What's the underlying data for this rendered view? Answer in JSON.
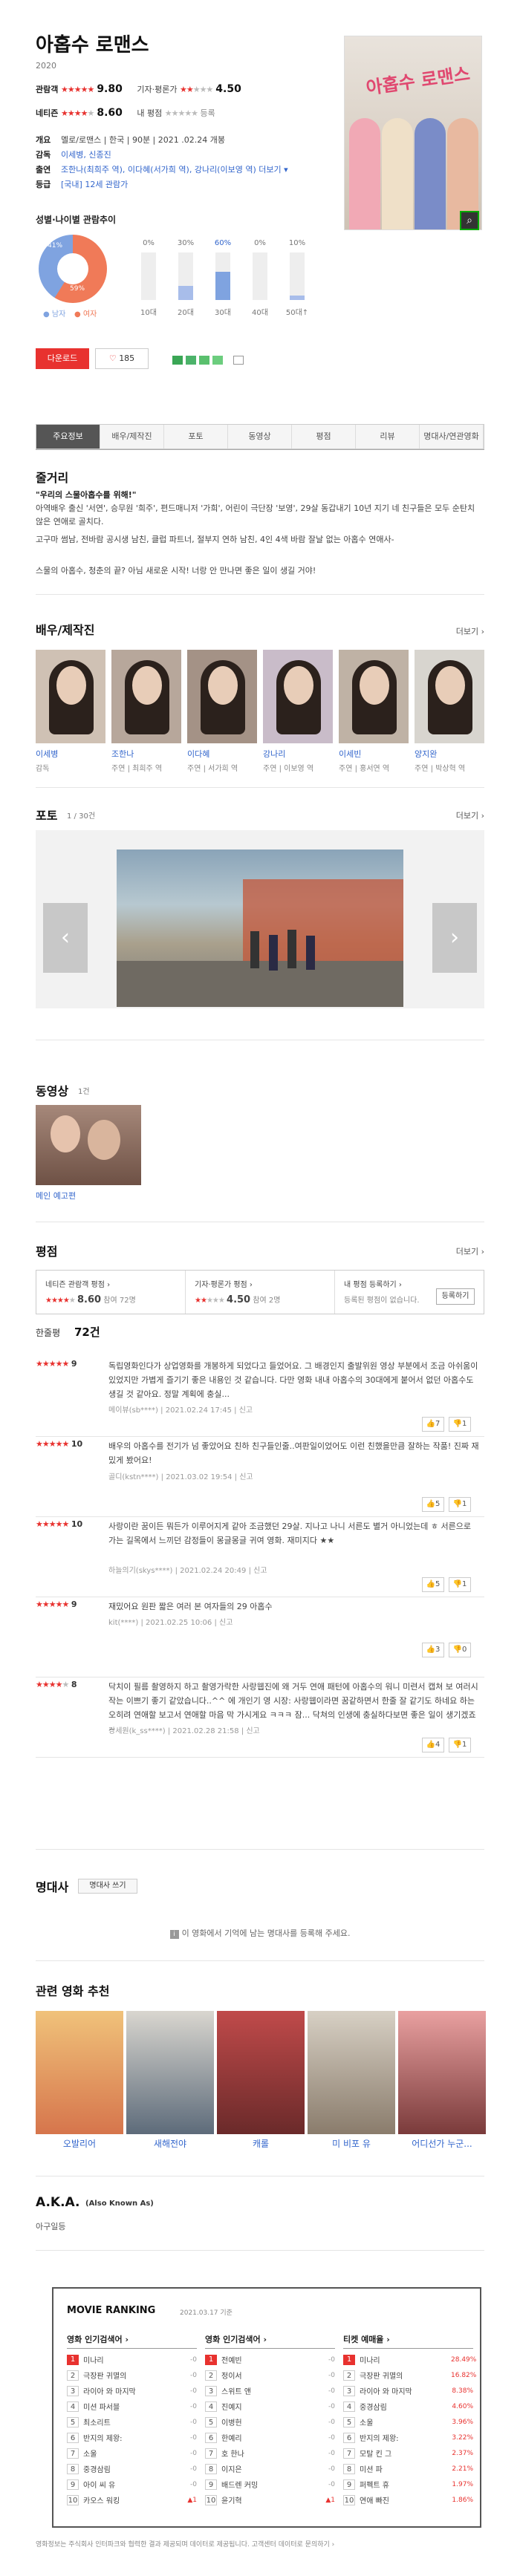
{
  "movie": {
    "title": "아홉수 로맨스",
    "year": "2020"
  },
  "info": {
    "audience_label": "관람객",
    "audience_score": "9.80",
    "critic_label": "기자·평론가",
    "critic_score": "4.50",
    "netizen_label": "네티즌",
    "netizen_score": "8.60",
    "my_label": "내 평점",
    "my_rate": "등록",
    "genre_label": "개요",
    "genre": "멜로/로맨스 | 한국 | 90분 | 2021 .02.24 개봉",
    "director_label": "감독",
    "director": "이세병, 신종진",
    "cast_label": "출연",
    "cast": "조한나(최희주 역), 이다혜(서가희 역), 강나리(이보영 역) 더보기 ▾",
    "rating_label": "등급",
    "rating": "[국내] 12세 관람가"
  },
  "gender": {
    "title": "성별·나이별 관람추이",
    "male_pct": "41%",
    "female_pct": "59%",
    "male": "● 남자",
    "female": "● 여자",
    "ages": [
      {
        "label": "10대",
        "pct": "0%",
        "v": 0
      },
      {
        "label": "20대",
        "pct": "30%",
        "v": 30
      },
      {
        "label": "30대",
        "pct": "60%",
        "v": 60
      },
      {
        "label": "40대",
        "pct": "0%",
        "v": 0
      },
      {
        "label": "50대↑",
        "pct": "10%",
        "v": 10
      }
    ]
  },
  "actions": {
    "download": "다운로드",
    "like_count": "185"
  },
  "tabs": [
    "주요정보",
    "배우/제작진",
    "포토",
    "동영상",
    "평점",
    "리뷰",
    "명대사/연관영화"
  ],
  "plot": {
    "title": "줄거리",
    "headline": "\"우리의 스물아홉수를 위해!\"",
    "body1": "아역배우 출신 '서연', 승무원 '희주', 편드매니저 '가희', 어린이 극단장 '보영', 29살 동갑내기 10년 지기 네 친구들은 모두 순탄치 않은 연애로 골치다.",
    "body2": "고구마 썸남, 전바람 공시생 남친, 클럽 파트너, 절부지 연하 남친, 4인 4색 바람 잘날 없는 아홉수 연애사-",
    "body3": "스물의 아홉수, 청춘의 끝? 아님 새로운 시작! 너랑 안 만나면 좋은 일이 생길 거야!"
  },
  "people": {
    "title": "배우/제작진",
    "more": "더보기 ›",
    "list": [
      {
        "name": "이세병",
        "role": "감독"
      },
      {
        "name": "조한나",
        "role": "주연 | 최희주 역"
      },
      {
        "name": "이다혜",
        "role": "주연 | 서가희 역"
      },
      {
        "name": "강나리",
        "role": "주연 | 이보영 역"
      },
      {
        "name": "이세빈",
        "role": "주연 | 홍서연 역"
      },
      {
        "name": "양지완",
        "role": "주연 | 박상혁 역"
      }
    ]
  },
  "photo": {
    "title": "포토",
    "count": "1 / 30건",
    "more": "더보기 ›"
  },
  "video": {
    "title": "동영상",
    "count": "1건",
    "name": "메인 예고편"
  },
  "ratings": {
    "title": "평점",
    "more": "더보기 ›",
    "netizen": {
      "label": "네티즌 관람객 평점 ›",
      "score": "8.60",
      "n": "참여 72명"
    },
    "critic": {
      "label": "기자·평론가 평점 ›",
      "score": "4.50",
      "n": "참여 2명"
    },
    "mine": {
      "label": "내 평점 등록하기 ›",
      "desc": "등록된 평점이 없습니다.",
      "btn": "등록하기"
    },
    "count_label": "한줄평",
    "count": "72건"
  },
  "reviews": [
    {
      "score": "9",
      "text": "독립영화인다가 상업영화를 개봉하게 되었다고 들었어요. 그 배경인지 출발위원 영상 부분에서 조금 아쉬움이 있었지만 가볍게 즐기기 좋은 내용인 것 같습니다. 다만 영화 내내 아홉수의 30대에게 붙어서 없던 아홉수도 생길 것 같아요. 정말 계획에 충실...",
      "user": "메이뷰(sb****)",
      "date": "2021.02.24 17:45",
      "up": "7",
      "down": "1"
    },
    {
      "score": "10",
      "text": "배우의 아홉수를 전기가 넘 좋았어요 친하 친구들인줄..여판일이었어도 이런 친했을만큼 잘하는 작품! 진짜 재밌게 봤어요!",
      "user": "골디(kstn****)",
      "date": "2021.03.02 19:54",
      "up": "5",
      "down": "1"
    },
    {
      "score": "10",
      "text": "사랑이란 꿈이든 뭐든가 이루어지게 같아 조금했던 29살. 지나고 나니 서른도 별거 아니었는데 ㅎ 서른으로 가는 길목에서 느끼던 감정들이 몽글몽글 귀여 영화. 재미지다 ★★",
      "user": "하늘의기(skys****)",
      "date": "2021.02.24 20:49",
      "up": "5",
      "down": "1"
    },
    {
      "score": "9",
      "text": "재밌어요 원판 짧은 여러 본 여자들의 29 아홉수",
      "user": "kit(****)",
      "date": "2021.02.25 10:06",
      "up": "3",
      "down": "0"
    },
    {
      "score": "8",
      "text": "닥치이 필름 촬영하지 하고 촬영가락한 사랑웹진에 왜 거두 연애 패턴에 아홉수의 워니 미련서 캡쳐 보 여러시작는 이쁘기 좋기 같았습니다..^^ 에 개인기 영 시장: 사랑웹이라면 꿈같하면서 한줄 잘 같기도 하네요 하는 오히려 연애할 보고서 연애할 마음 막 가시게요 ㅋㅋㅋ 잠... 닥쳐의 인생에 충실하다보면 좋은 일이 생기겠죠~",
      "user": "강세원(k_ss****)",
      "date": "2021.02.28 21:58",
      "up": "4",
      "down": "1"
    }
  ],
  "quotes": {
    "title": "명대사",
    "btn": "명대사 쓰기",
    "msg": "이 영화에서 기억에 남는 명대사를 등록해 주세요."
  },
  "related": {
    "title": "관련 영화 추천",
    "list": [
      "오발리어",
      "새해전야",
      "캐롤",
      "미 비포 유",
      "어디선가 누군..."
    ]
  },
  "aka": {
    "title": "A.K.A.",
    "sub": "(Also Known As)",
    "value": "아구일등"
  },
  "ranking": {
    "title": "MOVIE RANKING",
    "date": "2021.03.17 기준",
    "cols": [
      {
        "h": "영화 인기검색어 ›",
        "items": [
          "미나리",
          "극장판 귀멸의",
          "라이아 와 마지막",
          "미션 파서블",
          "최소리트",
          "반지의 제왕:",
          "소울",
          "중경삼림",
          "아이 씨 유",
          "카오스 워킹"
        ],
        "ch": [
          "-0",
          "-0",
          "-0",
          "-0",
          "-0",
          "-0",
          "-0",
          "-0",
          "-0",
          "▲1"
        ]
      },
      {
        "h": "영화 인기검색어 ›",
        "items": [
          "전예빈",
          "정이서",
          "스위트 앤",
          "진예지",
          "이병헌",
          "한예리",
          "호 한나",
          "이지은",
          "배드렌 커밍",
          "윤기혁"
        ],
        "ch": [
          "-0",
          "-0",
          "-0",
          "-0",
          "-0",
          "-0",
          "-0",
          "-0",
          "-0",
          "▲1"
        ]
      },
      {
        "h": "티켓 예매율 ›",
        "items": [
          "미나리",
          "극장판 귀멸의",
          "라이아 와 마지막",
          "중경삼림",
          "소울",
          "반지의 제왕:",
          "모탈 킨 그",
          "미션 파",
          "퍼펙트 휴",
          "연애 빠진"
        ],
        "ch": [
          "28.49%",
          "16.82%",
          "8.38%",
          "4.60%",
          "3.96%",
          "3.22%",
          "2.37%",
          "2.21%",
          "1.97%",
          "1.86%"
        ]
      }
    ]
  },
  "footer": "영화정보는 주식회사 인터파크와 협력한 결과 제공되며 데이터로 제공됩니다. 고객센터 데이터로 문의하기 ›"
}
